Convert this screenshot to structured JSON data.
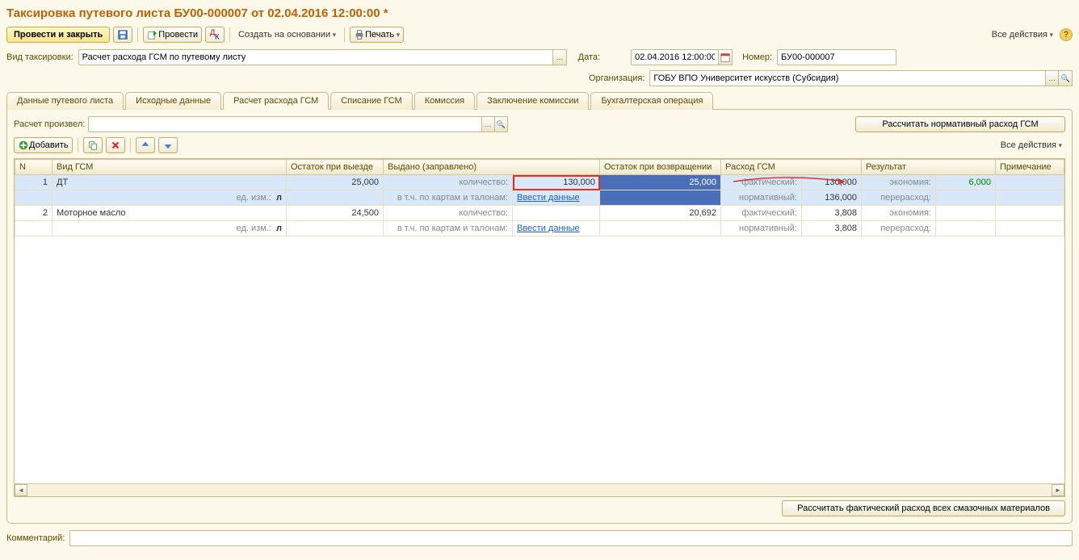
{
  "title": "Таксировка путевого листа БУ00-000007 от 02.04.2016 12:00:00 *",
  "toolbar": {
    "post_close": "Провести и закрыть",
    "post": "Провести",
    "create_based": "Создать на основании",
    "print": "Печать",
    "all_actions": "Все действия"
  },
  "fields": {
    "type_label": "Вид таксировки:",
    "type_value": "Расчет расхода ГСМ по путевому листу",
    "date_label": "Дата:",
    "date_value": "02.04.2016 12:00:00",
    "number_label": "Номер:",
    "number_value": "БУ00-000007",
    "org_label": "Организация:",
    "org_value": "ГОБУ ВПО Университет искусств (Субсидия)"
  },
  "tabs": [
    "Данные путевого листа",
    "Исходные данные",
    "Расчет расхода ГСМ",
    "Списание ГСМ",
    "Комиссия",
    "Заключение комиссии",
    "Бухгалтерская операция"
  ],
  "calc_by_label": "Расчет произвел:",
  "calc_by_value": "",
  "calc_norm_btn": "Рассчитать нормативный расход ГСМ",
  "add_btn": "Добавить",
  "all_actions2": "Все действия",
  "columns": [
    "N",
    "Вид ГСМ",
    "Остаток при выезде",
    "Выдано (заправлено)",
    "Остаток при возвращении",
    "Расход ГСМ",
    "Результат",
    "Примечание"
  ],
  "sub_labels": {
    "qty": "количество:",
    "cards": "в т.ч. по картам и талонам:",
    "unit": "ед. изм.:",
    "fact": "фактический:",
    "norm": "нормативный:",
    "econ": "экономия:",
    "over": "перерасход:",
    "enter": "Ввести данные"
  },
  "rows": [
    {
      "n": "1",
      "type": "ДТ",
      "unit": "л",
      "out": "25,000",
      "qty": "130,000",
      "ret": "25,000",
      "fact": "130,000",
      "norm": "136,000",
      "econ": "6,000",
      "over": ""
    },
    {
      "n": "2",
      "type": "Моторное масло",
      "unit": "л",
      "out": "24,500",
      "qty": "",
      "ret": "20,692",
      "fact": "3,808",
      "norm": "3,808",
      "econ": "",
      "over": ""
    }
  ],
  "calc_fact_btn": "Рассчитать фактический расход всех смазочных материалов",
  "comment_label": "Комментарий:",
  "comment_value": ""
}
